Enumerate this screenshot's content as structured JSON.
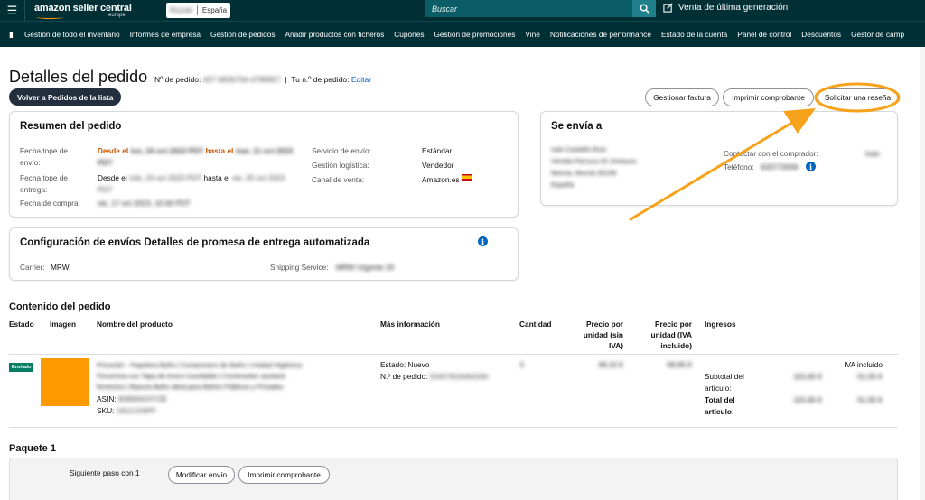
{
  "topbar": {
    "logo_main": "amazon seller central",
    "logo_sub": "europe",
    "marketplace_blurred": "Rtzoak",
    "marketplace": "España",
    "search_placeholder": "Buscar",
    "next_gen": "Venta de última generación"
  },
  "nav": {
    "items": [
      "Gestión de todo el inventario",
      "Informes de empresa",
      "Gestión de pedidos",
      "Añadir productos con ficheros",
      "Cupones",
      "Gestión de promociones",
      "Vine",
      "Notificaciones de performance",
      "Estado de la cuenta",
      "Panel de control",
      "Descuentos",
      "Gestor de camp"
    ]
  },
  "header": {
    "title": "Detalles del pedido",
    "order_label": "Nº de pedido:",
    "order_blurred": "407-6836756-4788957",
    "your_order_label": "Tu n.º de pedido:",
    "edit": "Editar",
    "back_button": "Volver a Pedidos de la lista",
    "manage_invoice": "Gestionar factura",
    "print_receipt": "Imprimir comprobante",
    "request_review": "Solicitar una reseña"
  },
  "summary": {
    "title": "Resumen del pedido",
    "ship_by_label": "Fecha tope de envío:",
    "ship_by_prefix": "Desde el",
    "ship_by_blur1": "lun, 24 oct 2023 PDT",
    "ship_by_mid": "hasta el",
    "ship_by_blur2": "mar, 11 oct",
    "ship_by_blur3": "2023 PDT",
    "deliver_by_label": "Fecha tope de entrega:",
    "deliver_by_prefix": "Desde el",
    "deliver_by_blur1": "mié, 23 oct 2023 PDT",
    "deliver_by_mid": "hasta el",
    "deliver_by_blur2": "vie, 25 oct",
    "deliver_by_blur3": "2023 PDT",
    "purchase_label": "Fecha de compra:",
    "purchase_blur": "vie, 17 oct 2023, 10:40 PDT",
    "shipping_service_label": "Servicio de envío:",
    "shipping_service": "Estándar",
    "fulfillment_label": "Gestión logística:",
    "fulfillment": "Vendedor",
    "channel_label": "Canal de venta:",
    "channel": "Amazon.es"
  },
  "ship_to": {
    "title": "Se envía a",
    "name_blur": "Iván Castaño Ruiz",
    "street_blur": "Vereda Parruca 33 Jmeauss",
    "city_blur": "Murcia, Murcia 30108",
    "country_blur": "España",
    "contact_label": "Contactar con el comprador:",
    "contact_blur": "Iván",
    "phone_label": "Teléfono:",
    "phone_blur": "633772009"
  },
  "config": {
    "title": "Configuración de envíos Detalles de promesa de entrega automatizada",
    "carrier_label": "Carrier:",
    "carrier": "MRW",
    "service_label": "Shipping Service:",
    "service_blur": "MRW Urgente 19"
  },
  "contents": {
    "title": "Contenido del pedido",
    "headers": {
      "status": "Estado",
      "image": "Imagen",
      "product": "Nombre del producto",
      "more_info": "Más información",
      "quantity": "Cantidad",
      "unit_price": "Precio por unidad (sin IVA)",
      "unit_price_iva": "Precio por unidad (IVA incluido)",
      "income": "Ingresos"
    },
    "row": {
      "status": "Enviado",
      "product_blur1": "Pricación - Papelera Baño | Compresero de Baño | Unidad Higiénica",
      "product_blur2": "Femenina con Tapa de Acero Inoxidable | Contenedor sanitario",
      "product_blur3": "femenino | Basura Baño Ideal para Baños Públicos y Privados",
      "asin_label": "ASIN:",
      "asin_blur": "B0B9NGFFZB",
      "sku_label": "SKU:",
      "sku_blur": "U61CGNPF",
      "state_label": "Estado:",
      "state": "Nuevo",
      "order_label": "N.º de pedido:",
      "order_blur": "55457816464260",
      "qty_blur": "3",
      "price_blur": "48,15 €",
      "price_iva_blur": "58,95 €",
      "iva_included": "IVA incluido",
      "subtotal_label": "Subtotal del artículo:",
      "subtotal_blur": "115,65 €",
      "subtotal_iva_blur": "51,55 €",
      "total_label": "Total del artículo:",
      "total_blur": "115,65 €",
      "total_iva_blur": "51,55 €"
    }
  },
  "package": {
    "title": "Paquete 1",
    "next_step": "Siguiente paso con 1",
    "modify": "Modificar envío",
    "print": "Imprimir comprobante"
  },
  "colors": {
    "topbar": "#002f36",
    "accent_orange": "#ff9900",
    "link": "#0066c0",
    "status_green": "#067d62"
  }
}
